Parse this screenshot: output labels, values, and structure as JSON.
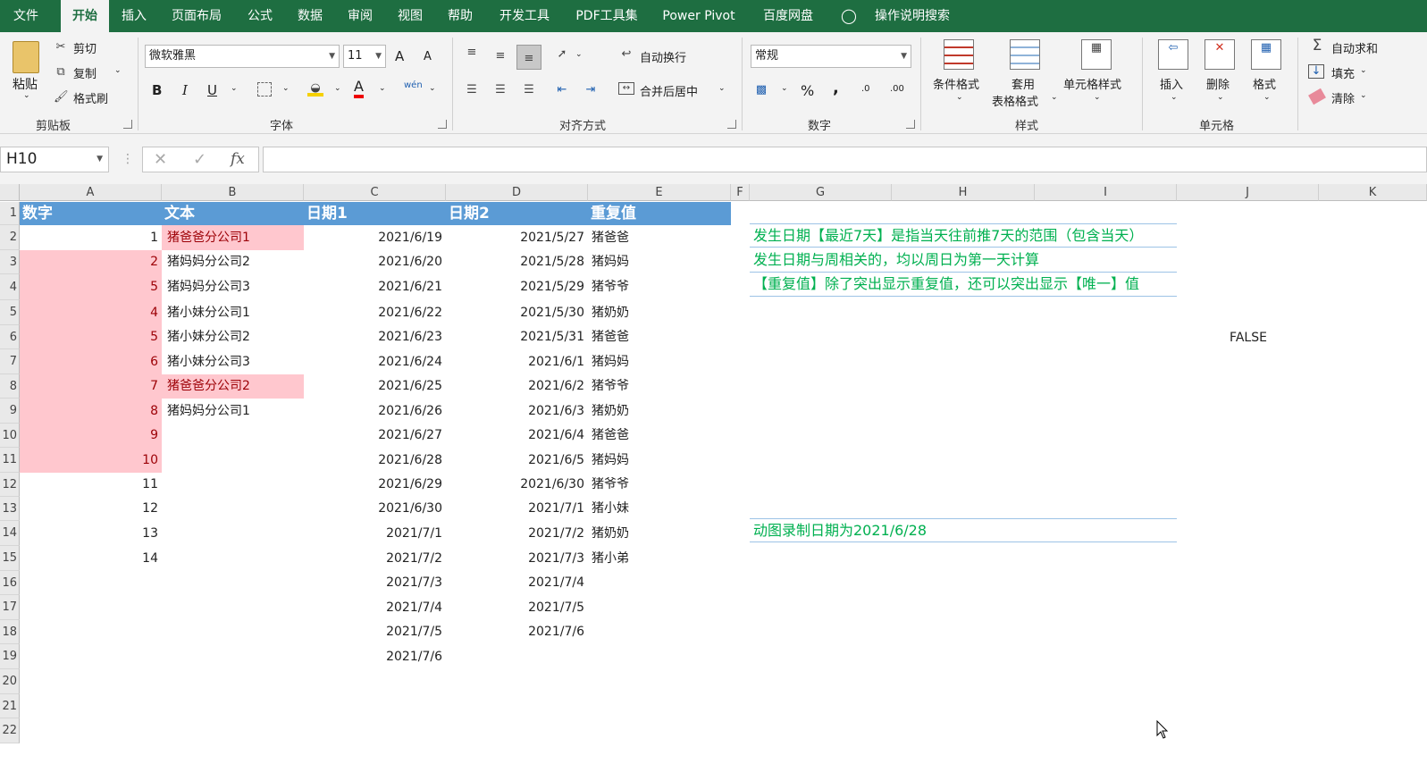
{
  "tabs": {
    "file": "文件",
    "home": "开始",
    "insert": "插入",
    "layout": "页面布局",
    "formulas": "公式",
    "data": "数据",
    "review": "审阅",
    "view": "视图",
    "help": "帮助",
    "developer": "开发工具",
    "pdf": "PDF工具集",
    "powerpivot": "Power Pivot",
    "baidu": "百度网盘",
    "search": "操作说明搜索"
  },
  "clipboard": {
    "paste": "粘贴",
    "cut": "剪切",
    "copy": "复制",
    "painter": "格式刷",
    "group": "剪贴板"
  },
  "font": {
    "name": "微软雅黑",
    "size": "11",
    "bold": "B",
    "italic": "I",
    "underline": "U",
    "group": "字体",
    "grow": "A",
    "shrink": "A",
    "color_a": "A",
    "wen": "wén"
  },
  "alignment": {
    "wrap": "自动换行",
    "merge": "合并后居中",
    "group": "对齐方式"
  },
  "number": {
    "format": "常规",
    "percent": "%",
    "comma": ",",
    "inc": ".0",
    "dec": ".00",
    "group": "数字"
  },
  "styles": {
    "conditional": "条件格式",
    "table1": "套用",
    "table2": "表格格式",
    "cell": "单元格样式",
    "group": "样式"
  },
  "cells": {
    "insert": "插入",
    "delete": "删除",
    "format": "格式",
    "group": "单元格"
  },
  "editing": {
    "autosum": "自动求和",
    "fill": "填充",
    "clear": "清除"
  },
  "formula_bar": {
    "name_box": "H10",
    "fx": "fx",
    "value": ""
  },
  "columns": [
    "A",
    "B",
    "C",
    "D",
    "E",
    "F",
    "G",
    "H",
    "I",
    "J",
    "K"
  ],
  "rows": [
    "1",
    "2",
    "3",
    "4",
    "5",
    "6",
    "7",
    "8",
    "9",
    "10",
    "11",
    "12",
    "13",
    "14",
    "15",
    "16",
    "17",
    "18",
    "19",
    "20",
    "21",
    "22"
  ],
  "headers": {
    "a": "数字",
    "b": "文本",
    "c": "日期1",
    "d": "日期2",
    "e": "重复值"
  },
  "col_a": [
    "1",
    "2",
    "5",
    "4",
    "5",
    "6",
    "7",
    "8",
    "9",
    "10",
    "11",
    "12",
    "13",
    "14"
  ],
  "col_b": [
    "猪爸爸分公司1",
    "猪妈妈分公司2",
    "猪妈妈分公司3",
    "猪小妹分公司1",
    "猪小妹分公司2",
    "猪小妹分公司3",
    "猪爸爸分公司2",
    "猪妈妈分公司1"
  ],
  "col_c": [
    "2021/6/19",
    "2021/6/20",
    "2021/6/21",
    "2021/6/22",
    "2021/6/23",
    "2021/6/24",
    "2021/6/25",
    "2021/6/26",
    "2021/6/27",
    "2021/6/28",
    "2021/6/29",
    "2021/6/30",
    "2021/7/1",
    "2021/7/2",
    "2021/7/3",
    "2021/7/4",
    "2021/7/5",
    "2021/7/6"
  ],
  "col_d": [
    "2021/5/27",
    "2021/5/28",
    "2021/5/29",
    "2021/5/30",
    "2021/5/31",
    "2021/6/1",
    "2021/6/2",
    "2021/6/3",
    "2021/6/4",
    "2021/6/5",
    "2021/6/30",
    "2021/7/1",
    "2021/7/2",
    "2021/7/3",
    "2021/7/4",
    "2021/7/5",
    "2021/7/6"
  ],
  "col_e": [
    "猪爸爸",
    "猪妈妈",
    "猪爷爷",
    "猪奶奶",
    "猪爸爸",
    "猪妈妈",
    "猪爷爷",
    "猪奶奶",
    "猪爸爸",
    "猪妈妈",
    "猪爷爷",
    "猪小妹",
    "猪奶奶",
    "猪小弟"
  ],
  "notes": {
    "n1": "发生日期【最近7天】是指当天往前推7天的范围（包含当天）",
    "n2": "发生日期与周相关的，均以周日为第一天计算",
    "n3": "【重复值】除了突出显示重复值，还可以突出显示【唯一】值",
    "n4": "动图录制日期为2021/6/28"
  },
  "j6": "FALSE",
  "colors": {
    "excel_green": "#1e6e41",
    "header_blue": "#5b9bd5",
    "pink_fill": "#ffc7ce",
    "pink_text": "#9c0006",
    "note_green": "#00b050"
  }
}
